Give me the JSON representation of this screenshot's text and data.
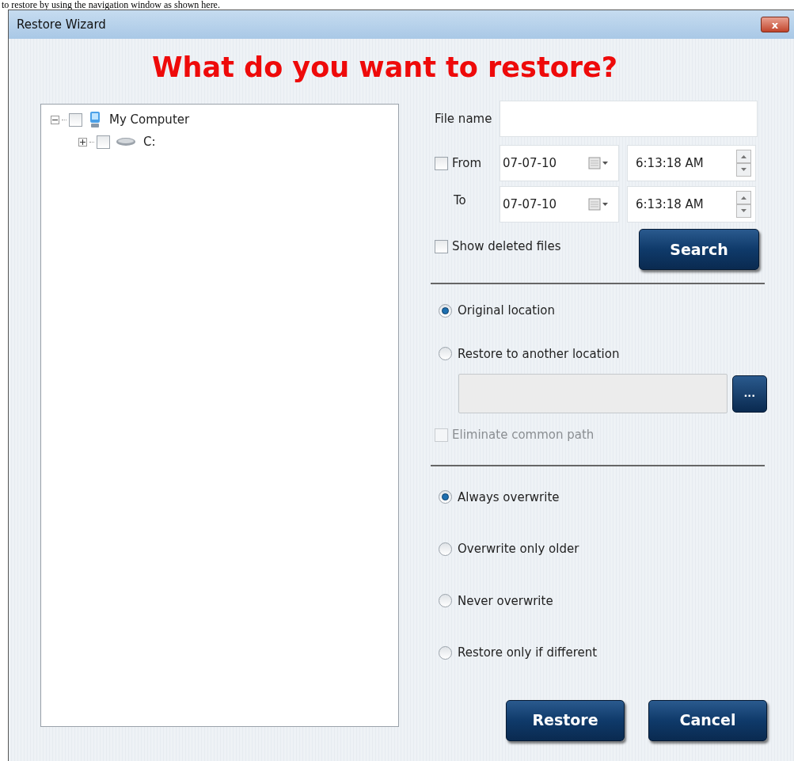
{
  "document_text": "to restore by using the navigation window as shown here.",
  "window": {
    "title": "Restore Wizard",
    "close": "x"
  },
  "heading": "What do you want to restore?",
  "tree": [
    {
      "label": "My Computer",
      "kind": "computer",
      "expanded": true,
      "checked": false,
      "children": [
        {
          "label": "C:",
          "kind": "drive",
          "expanded": false,
          "checked": false
        }
      ]
    }
  ],
  "search": {
    "file_name_label": "File name",
    "from": {
      "label": "From",
      "checked": false,
      "date": "07-07-10",
      "time": "6:13:18 AM"
    },
    "to": {
      "label": "To",
      "date": "07-07-10",
      "time": "6:13:18 AM"
    },
    "show_deleted": {
      "label": "Show deleted files",
      "checked": false
    },
    "button": "Search"
  },
  "location_options": [
    {
      "label": "Original location",
      "selected": true
    },
    {
      "label": "Restore to another location",
      "selected": false
    }
  ],
  "browse_button": "...",
  "eliminate_common_path": {
    "label": "Eliminate common path",
    "checked": false,
    "disabled": true
  },
  "overwrite_options": [
    {
      "label": "Always overwrite",
      "selected": true
    },
    {
      "label": "Overwrite only older",
      "selected": false
    },
    {
      "label": "Never overwrite",
      "selected": false
    },
    {
      "label": "Restore only if different",
      "selected": false
    }
  ],
  "buttons": [
    "Restore",
    "Cancel"
  ]
}
